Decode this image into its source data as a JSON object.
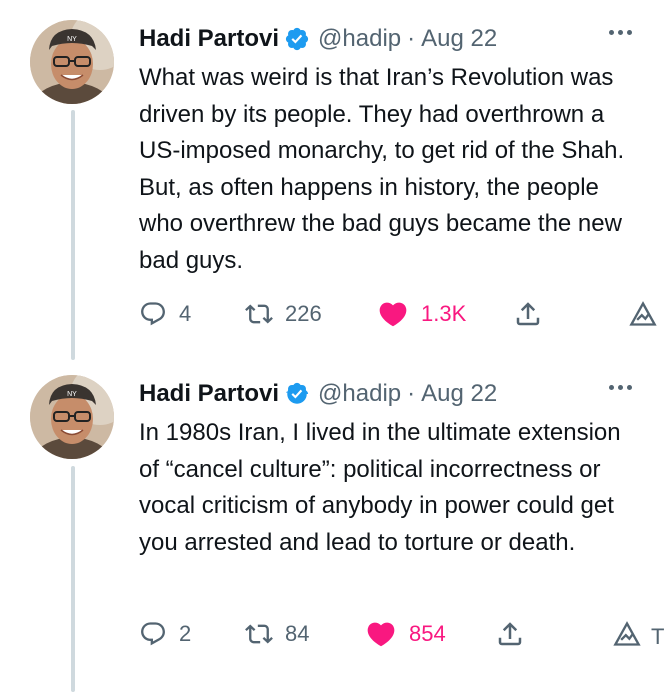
{
  "tweets": [
    {
      "author": {
        "name": "Hadi Partovi",
        "handle": "@hadip"
      },
      "separator": "·",
      "date": "Aug 22",
      "text": "What was weird is that Iran’s Revolution was driven by its people. They had overthrown a US-imposed monarchy, to get rid of the Shah. But, as often happens in history, the people who overthrew the bad guys became the new bad guys.",
      "replies": "4",
      "retweets": "226",
      "likes": "1.3K"
    },
    {
      "author": {
        "name": "Hadi Partovi",
        "handle": "@hadip"
      },
      "separator": "·",
      "date": "Aug 22",
      "text": "In 1980s Iran, I lived in the ultimate extension of “cancel culture”: political incorrectness or vocal criticism of anybody in power could get you arrested and lead to torture or death.",
      "replies": "2",
      "retweets": "84",
      "likes": "854",
      "cut_off_label": "T"
    }
  ],
  "colors": {
    "text": "#0f1419",
    "secondary": "#536471",
    "verified": "#1d9bf0",
    "like": "#f91880",
    "thread_line": "#cfd9de"
  },
  "icons": [
    "verified-badge-icon",
    "more-icon",
    "reply-icon",
    "retweet-icon",
    "heart-icon",
    "share-icon",
    "analytics-icon"
  ]
}
